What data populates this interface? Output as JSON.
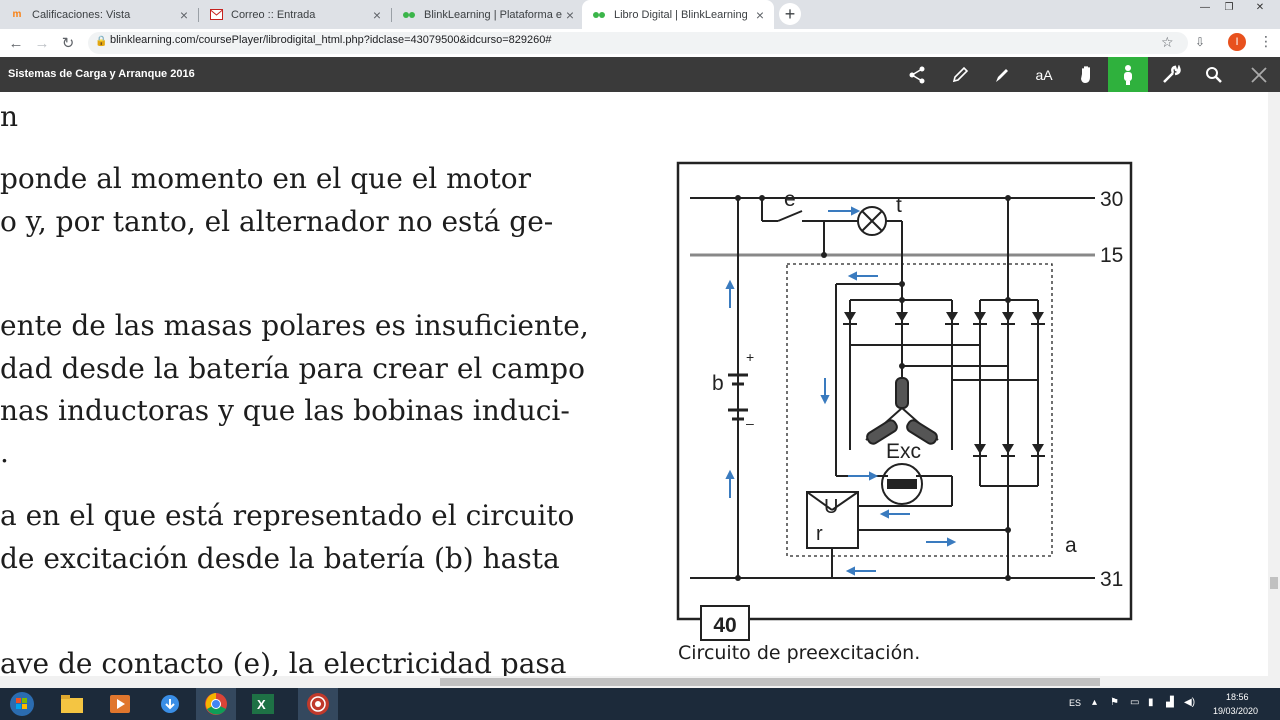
{
  "browser": {
    "tabs": [
      {
        "title": "Calificaciones: Vista",
        "active": false
      },
      {
        "title": "Correo :: Entrada",
        "active": false
      },
      {
        "title": "BlinkLearning | Plataforma educa",
        "active": false
      },
      {
        "title": "Libro Digital | BlinkLearning",
        "active": true
      }
    ],
    "url": "blinklearning.com/coursePlayer/librodigital_html.php?idclase=43079500&idcurso=829260#",
    "profile_initial": "I"
  },
  "app": {
    "title": "Sistemas de Carga y Arranque 2016",
    "toolbar_icons": [
      "share-icon",
      "pencil-icon",
      "highlighter-icon",
      "text-size-icon",
      "hand-icon",
      "pointer-icon",
      "wrench-icon",
      "search-icon",
      "close-icon"
    ]
  },
  "book": {
    "heading_fragment": "n",
    "paragraphs": [
      [
        "ponde al momento en el que el motor",
        "o y, por tanto, el alternador no está ge-"
      ],
      [
        "ente de las masas polares es insuficiente,",
        "dad desde la batería para crear el campo",
        "nas inductoras y que las bobinas induci-",
        "."
      ],
      [
        "a en el que está representado el circuito",
        "de excitación desde la batería (b) hasta"
      ],
      [
        "ave de contacto (e), la electricidad pasa"
      ]
    ],
    "figure": {
      "number": "40",
      "caption": "Circuito de preexcitación.",
      "labels": {
        "e": "e",
        "t": "t",
        "b": "b",
        "plus": "+",
        "minus": "–",
        "exc": "Exc",
        "u": "U",
        "r": "r",
        "a": "a",
        "t30": "30",
        "t15": "15",
        "t31": "31"
      }
    }
  },
  "taskbar": {
    "lang": "ES",
    "time": "18:56",
    "date": "19/03/2020"
  }
}
